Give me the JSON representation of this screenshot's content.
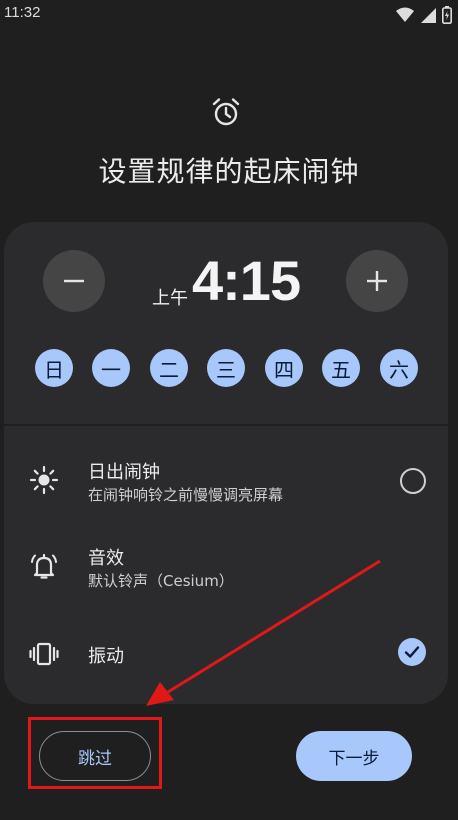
{
  "status_bar": {
    "time": "11:32"
  },
  "header": {
    "title": "设置规律的起床闹钟"
  },
  "time_picker": {
    "ampm": "上午",
    "time": "4:15"
  },
  "days": [
    "日",
    "一",
    "二",
    "三",
    "四",
    "五",
    "六"
  ],
  "settings": {
    "sunrise": {
      "title": "日出闹钟",
      "subtitle": "在闹钟响铃之前慢慢调亮屏幕"
    },
    "sound": {
      "title": "音效",
      "subtitle": "默认铃声（Cesium）"
    },
    "vibrate": {
      "title": "振动"
    }
  },
  "footer": {
    "skip_label": "跳过",
    "next_label": "下一步"
  },
  "colors": {
    "accent": "#a8c7fa",
    "background": "#1f1f1f",
    "card": "#2b2b2e",
    "annotation_red": "#e01818"
  }
}
